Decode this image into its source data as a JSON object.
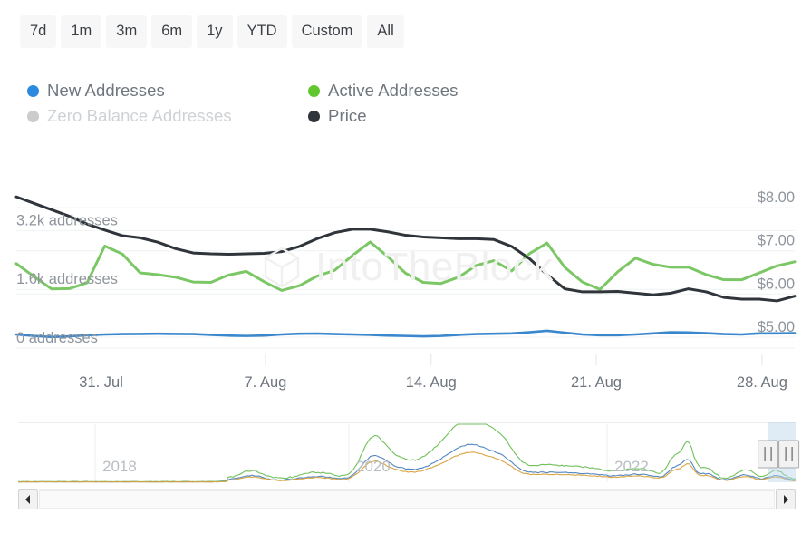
{
  "range_selector": {
    "buttons": [
      {
        "label": "7d",
        "selected": false
      },
      {
        "label": "1m",
        "selected": false
      },
      {
        "label": "3m",
        "selected": false
      },
      {
        "label": "6m",
        "selected": false
      },
      {
        "label": "1y",
        "selected": false
      },
      {
        "label": "YTD",
        "selected": false
      },
      {
        "label": "Custom",
        "selected": false
      },
      {
        "label": "All",
        "selected": false
      }
    ]
  },
  "legend": {
    "items": [
      {
        "label": "New Addresses",
        "color": "#2b8ae0",
        "disabled": false
      },
      {
        "label": "Active Addresses",
        "color": "#62c62e",
        "disabled": false
      },
      {
        "label": "Zero Balance Addresses",
        "color": "#cccccc",
        "disabled": true
      },
      {
        "label": "Price",
        "color": "#2f353b",
        "disabled": false
      }
    ]
  },
  "watermark": {
    "text": "IntoTheBlock"
  },
  "navigator": {
    "year_labels": [
      "2018",
      "2020",
      "2022"
    ],
    "selection": {
      "from_pct": 96.4,
      "to_pct": 100
    },
    "scroll": {
      "thumb_left_pct": 0,
      "thumb_width_pct": 100
    }
  },
  "chart_data": {
    "type": "line",
    "title": "",
    "xlabel": "",
    "ylabel": "addresses",
    "y_left": {
      "ticks": [
        "0 addresses",
        "1.6k addresses",
        "3.2k addresses"
      ],
      "tick_values": [
        0,
        1600,
        3200
      ],
      "min": 0,
      "max": 4000
    },
    "y_right": {
      "ticks": [
        "$5.00",
        "$6.00",
        "$7.00",
        "$8.00"
      ],
      "tick_values": [
        5,
        6,
        7,
        8
      ],
      "min": 4.6,
      "max": 8.4,
      "label": "Price"
    },
    "x_ticks": [
      "31. Jul",
      "7. Aug",
      "14. Aug",
      "21. Aug",
      "28. Aug"
    ],
    "x_tick_positions_pct": [
      10.9,
      32.0,
      53.3,
      74.5,
      95.8
    ],
    "grid": true,
    "legend_position": "top-left",
    "series": [
      {
        "name": "Active Addresses",
        "color": "#7cc765",
        "axis": "left",
        "unit": "addresses",
        "values": [
          2300,
          1950,
          1610,
          1620,
          1780,
          2780,
          2560,
          2050,
          2000,
          1930,
          1800,
          1790,
          1990,
          2090,
          1810,
          1570,
          1700,
          1960,
          2120,
          2520,
          2890,
          2490,
          2040,
          1790,
          1760,
          1930,
          2250,
          2380,
          2100,
          2570,
          2860,
          2200,
          1800,
          1600,
          2080,
          2450,
          2280,
          2200,
          2200,
          2000,
          1860,
          1860,
          2050,
          2240,
          2350
        ]
      },
      {
        "name": "Price",
        "color": "#2f353b",
        "axis": "right",
        "unit": "USD",
        "values": [
          8.25,
          8.1,
          7.95,
          7.8,
          7.62,
          7.48,
          7.35,
          7.3,
          7.2,
          7.05,
          6.95,
          6.93,
          6.92,
          6.93,
          6.94,
          6.98,
          7.1,
          7.28,
          7.42,
          7.5,
          7.5,
          7.44,
          7.36,
          7.32,
          7.3,
          7.28,
          7.28,
          7.26,
          7.1,
          6.82,
          6.45,
          6.12,
          6.05,
          6.05,
          6.06,
          6.02,
          5.98,
          6.02,
          6.12,
          6.05,
          5.92,
          5.88,
          5.88,
          5.84,
          5.95
        ]
      },
      {
        "name": "New Addresses",
        "color": "#3b87cc",
        "axis": "left",
        "unit": "addresses",
        "values": [
          370,
          330,
          300,
          320,
          350,
          370,
          380,
          385,
          390,
          385,
          380,
          360,
          340,
          330,
          340,
          370,
          390,
          395,
          380,
          370,
          360,
          340,
          330,
          320,
          330,
          360,
          380,
          390,
          400,
          430,
          470,
          420,
          370,
          350,
          350,
          370,
          400,
          430,
          425,
          405,
          380,
          370,
          400,
          400,
          405
        ]
      }
    ],
    "navigator_series": [
      {
        "name": "Active Addresses",
        "color": "#70c05a"
      },
      {
        "name": "New Addresses",
        "color": "#5487c0"
      },
      {
        "name": "Zero Balance Addresses",
        "color": "#d9a441"
      }
    ]
  }
}
